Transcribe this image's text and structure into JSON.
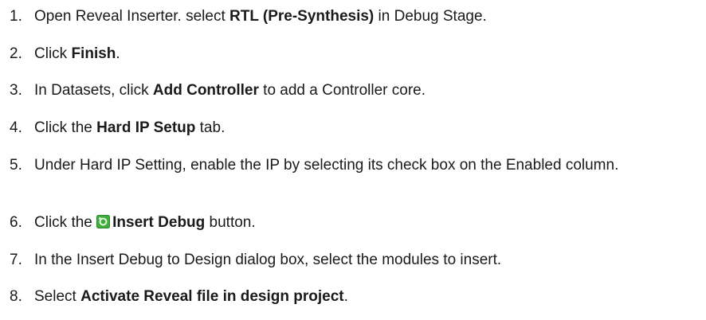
{
  "steps": [
    {
      "number": "1.",
      "pre": "Open Reveal Inserter. select ",
      "bold": "RTL (Pre-Synthesis)",
      "post": " in Debug Stage."
    },
    {
      "number": "2.",
      "pre": "Click ",
      "bold": "Finish",
      "post": "."
    },
    {
      "number": "3.",
      "pre": "In Datasets, click ",
      "bold": "Add Controller",
      "post": " to add a Controller core."
    },
    {
      "number": "4.",
      "pre": "Click the ",
      "bold": "Hard IP Setup",
      "post": " tab."
    },
    {
      "number": "5.",
      "text": "Under Hard IP Setting, enable the IP by selecting its check box on the Enabled column."
    },
    {
      "number": "6.",
      "pre": "Click the ",
      "icon": "insert-debug-icon",
      "bold": "Insert Debug",
      "post": " button."
    },
    {
      "number": "7.",
      "text": "In the Insert Debug to Design dialog box, select the modules to insert."
    },
    {
      "number": "8.",
      "pre": "Select ",
      "bold": "Activate Reveal file in design project",
      "post": "."
    }
  ],
  "colors": {
    "text": "#1a1a1a",
    "icon_green": "#3fae3a"
  }
}
